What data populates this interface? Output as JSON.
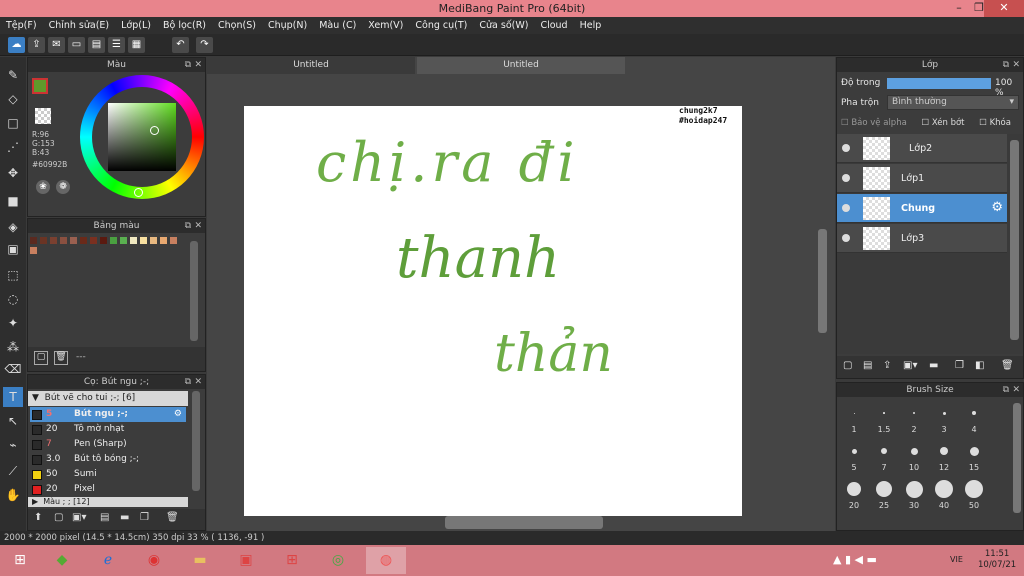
{
  "window": {
    "title": "MediBang Paint Pro (64bit)"
  },
  "menu": [
    "Tệp(F)",
    "Chỉnh sửa(E)",
    "Lớp(L)",
    "Bộ lọc(R)",
    "Chọn(S)",
    "Chụp(N)",
    "Màu (C)",
    "Xem(V)",
    "Công cụ(T)",
    "Cửa số(W)",
    "Cloud",
    "Help"
  ],
  "tabs": [
    "Untitled",
    "Untitled"
  ],
  "color_panel": {
    "title": "Màu",
    "r": "R:96",
    "g": "G:153",
    "b": "B:43",
    "hex": "#60992B",
    "primary": "#60992b"
  },
  "palette_panel": {
    "title": "Bảng màu",
    "colors": [
      "#5a2a20",
      "#6a3424",
      "#7a4030",
      "#8a5040",
      "#9a6050",
      "#6a2a1a",
      "#7a3020",
      "#5a1a10",
      "#4aa040",
      "#5ab050",
      "#f0e8c0",
      "#f8e0a0",
      "#e8b880",
      "#e8a870",
      "#c88060"
    ],
    "footer": "---"
  },
  "brush_panel": {
    "title": "Cọ: Bút ngu ;-;",
    "group": "Bút vẽ cho tui ;-; [6]",
    "group2": "Màu ; ; [12]",
    "items": [
      {
        "size": "5",
        "name": "Bút ngu ;-;",
        "color": "#2a2a2a"
      },
      {
        "size": "20",
        "name": "Tô mờ nhạt",
        "color": "#2a2a2a"
      },
      {
        "size": "7",
        "name": "Pen (Sharp)",
        "color": "#2a2a2a"
      },
      {
        "size": "3.0",
        "name": "Bút tô bóng ;-;",
        "color": "#2a2a2a"
      },
      {
        "size": "50",
        "name": "Sumi",
        "color": "#f0d010"
      },
      {
        "size": "20",
        "name": "Pixel",
        "color": "#e02020"
      }
    ]
  },
  "canvas": {
    "watermark1": "chung2k7",
    "watermark2": "#hoidap247",
    "line1": "chị.ra đi",
    "line2": "thanh",
    "line3": "thản"
  },
  "layer_panel": {
    "title": "Lớp",
    "opacity_label": "Độ trong",
    "opacity_value": "100 %",
    "blend_label": "Pha trộn",
    "blend_value": "Bình thường",
    "protect_alpha": "Bảo vệ alpha",
    "clipping": "Xén bớt",
    "lock": "Khóa",
    "layers": [
      "Lớp2",
      "Lớp1",
      "Chung",
      "Lớp3"
    ]
  },
  "brush_size_panel": {
    "title": "Brush Size",
    "sizes": [
      "1",
      "1.5",
      "2",
      "3",
      "4",
      "5",
      "7",
      "10",
      "12",
      "15",
      "20",
      "25",
      "30",
      "40",
      "50"
    ]
  },
  "status": {
    "text": "2000 * 2000 pixel   (14.5 * 14.5cm)   350 dpi   33 %   ( 1136, -91 )"
  },
  "taskbar": {
    "lang": "VIE",
    "time": "11:51",
    "date": "10/07/21"
  },
  "colors": {
    "accent": "#3b7fc4",
    "ink": "#6fae48",
    "titlebar": "#e8848c"
  }
}
